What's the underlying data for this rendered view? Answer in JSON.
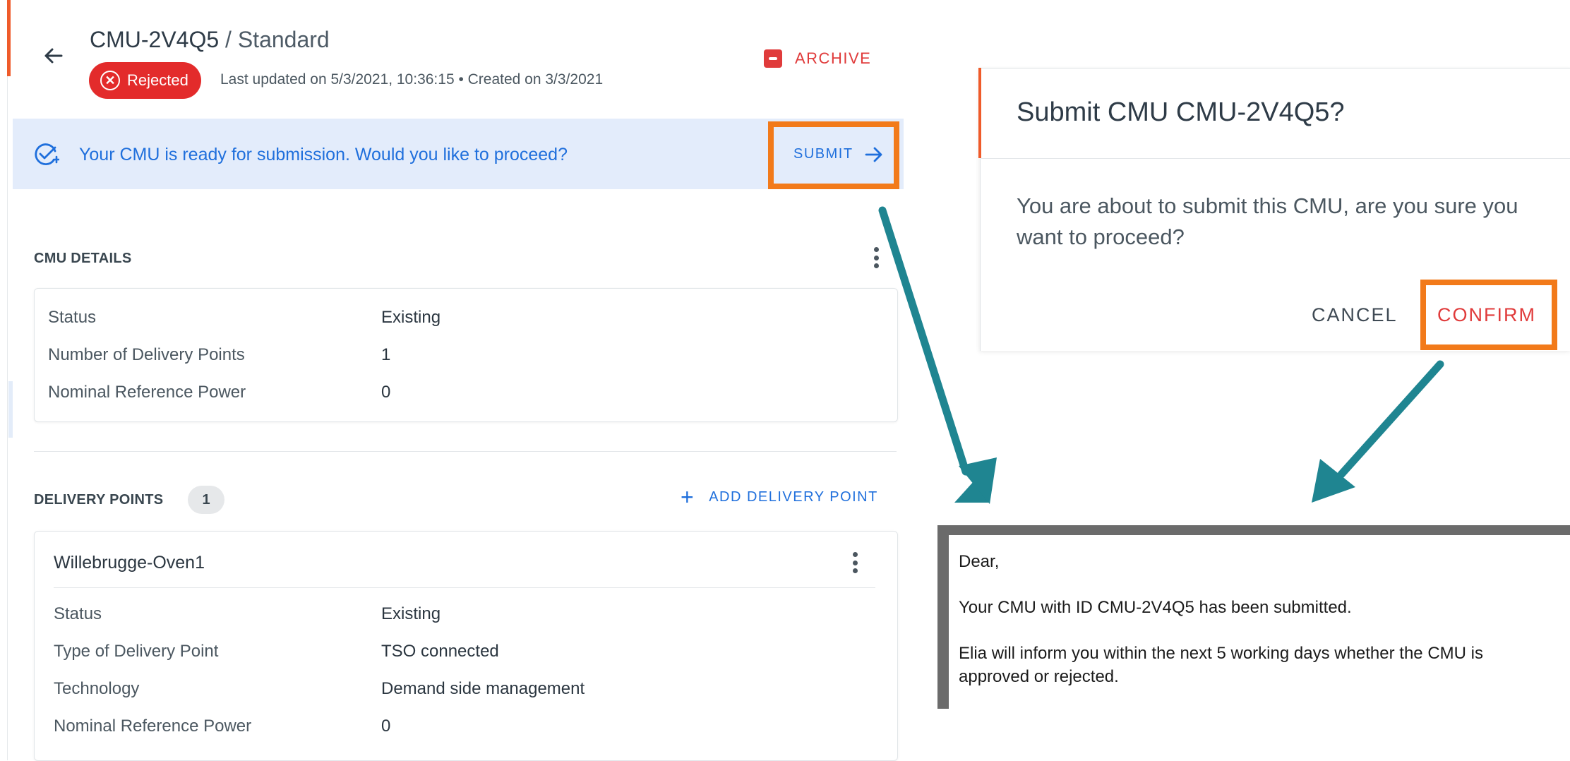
{
  "header": {
    "cmu_id": "CMU-2V4Q5",
    "cmu_type": " / Standard",
    "status_badge": "Rejected",
    "updated_text": "Last updated on 5/3/2021, 10:36:15 • Created on 3/3/2021",
    "archive_label": "ARCHIVE"
  },
  "banner": {
    "message": "Your CMU is ready for submission. Would you like to proceed?",
    "submit_label": "SUBMIT"
  },
  "cmu_details": {
    "title": "CMU DETAILS",
    "rows": [
      {
        "label": "Status",
        "value": "Existing"
      },
      {
        "label": "Number of Delivery Points",
        "value": "1"
      },
      {
        "label": "Nominal Reference Power",
        "value": "0"
      }
    ]
  },
  "delivery_points": {
    "title": "DELIVERY POINTS",
    "count": "1",
    "add_label": "ADD DELIVERY POINT",
    "items": [
      {
        "name": "Willebrugge-Oven1",
        "rows": [
          {
            "label": "Status",
            "value": "Existing"
          },
          {
            "label": "Type of Delivery Point",
            "value": "TSO connected"
          },
          {
            "label": "Technology",
            "value": "Demand side management"
          },
          {
            "label": "Nominal Reference Power",
            "value": "0"
          }
        ]
      }
    ]
  },
  "dialog": {
    "title": "Submit CMU CMU-2V4Q5?",
    "body": "You are about to submit this CMU, are you sure you want to proceed?",
    "cancel_label": "CANCEL",
    "confirm_label": "CONFIRM"
  },
  "email": {
    "greeting": "Dear,",
    "line1": "Your CMU with ID CMU-2V4Q5 has been submitted.",
    "line2a": "Elia will inform you within the next 5 working days whether the CMU is",
    "line2b": "approved or rejected."
  },
  "colors": {
    "highlight_orange": "#f27a1a",
    "arrow_teal": "#1f8591",
    "primary_blue": "#1f6fdc",
    "danger_red": "#e32b2b"
  }
}
